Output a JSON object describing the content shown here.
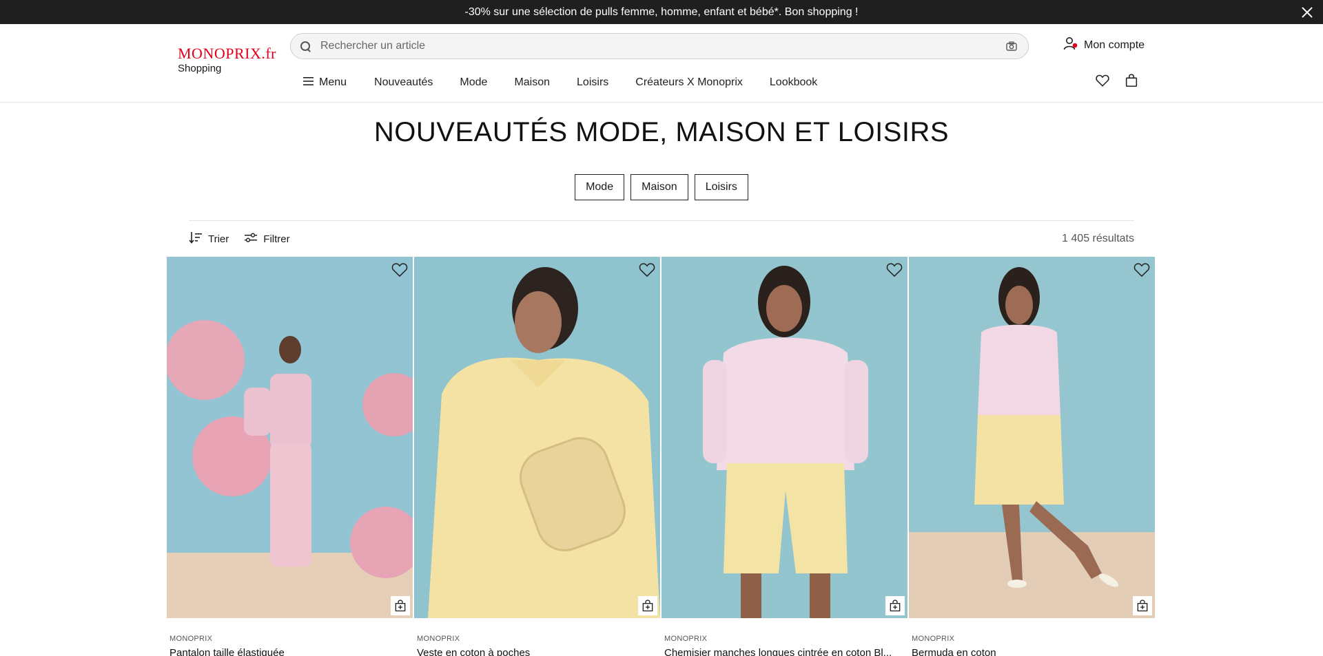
{
  "promo": {
    "text": "-30% sur une sélection de pulls femme, homme, enfant et bébé*. Bon shopping !"
  },
  "logo": {
    "brand": "MONOPRIX.fr",
    "sub": "Shopping"
  },
  "search": {
    "placeholder": "Rechercher un article"
  },
  "account": {
    "label": "Mon compte"
  },
  "nav": {
    "menu_label": "Menu",
    "items": [
      "Nouveautés",
      "Mode",
      "Maison",
      "Loisirs",
      "Créateurs X Monoprix",
      "Lookbook"
    ]
  },
  "page": {
    "title": "NOUVEAUTÉS MODE, MAISON ET LOISIRS",
    "chips": [
      "Mode",
      "Maison",
      "Loisirs"
    ]
  },
  "toolbar": {
    "sort_label": "Trier",
    "filter_label": "Filtrer",
    "results": "1 405 résultats"
  },
  "products": [
    {
      "brand": "MONOPRIX",
      "name": "Pantalon taille élastiquée"
    },
    {
      "brand": "MONOPRIX",
      "name": "Veste en coton à poches"
    },
    {
      "brand": "MONOPRIX",
      "name": "Chemisier manches longues cintrée en coton Bl..."
    },
    {
      "brand": "MONOPRIX",
      "name": "Bermuda en coton"
    }
  ],
  "colors": {
    "brand_red": "#e2001a",
    "banner_bg": "#1f1f1f",
    "photo_bg": "#8fc3d1"
  }
}
